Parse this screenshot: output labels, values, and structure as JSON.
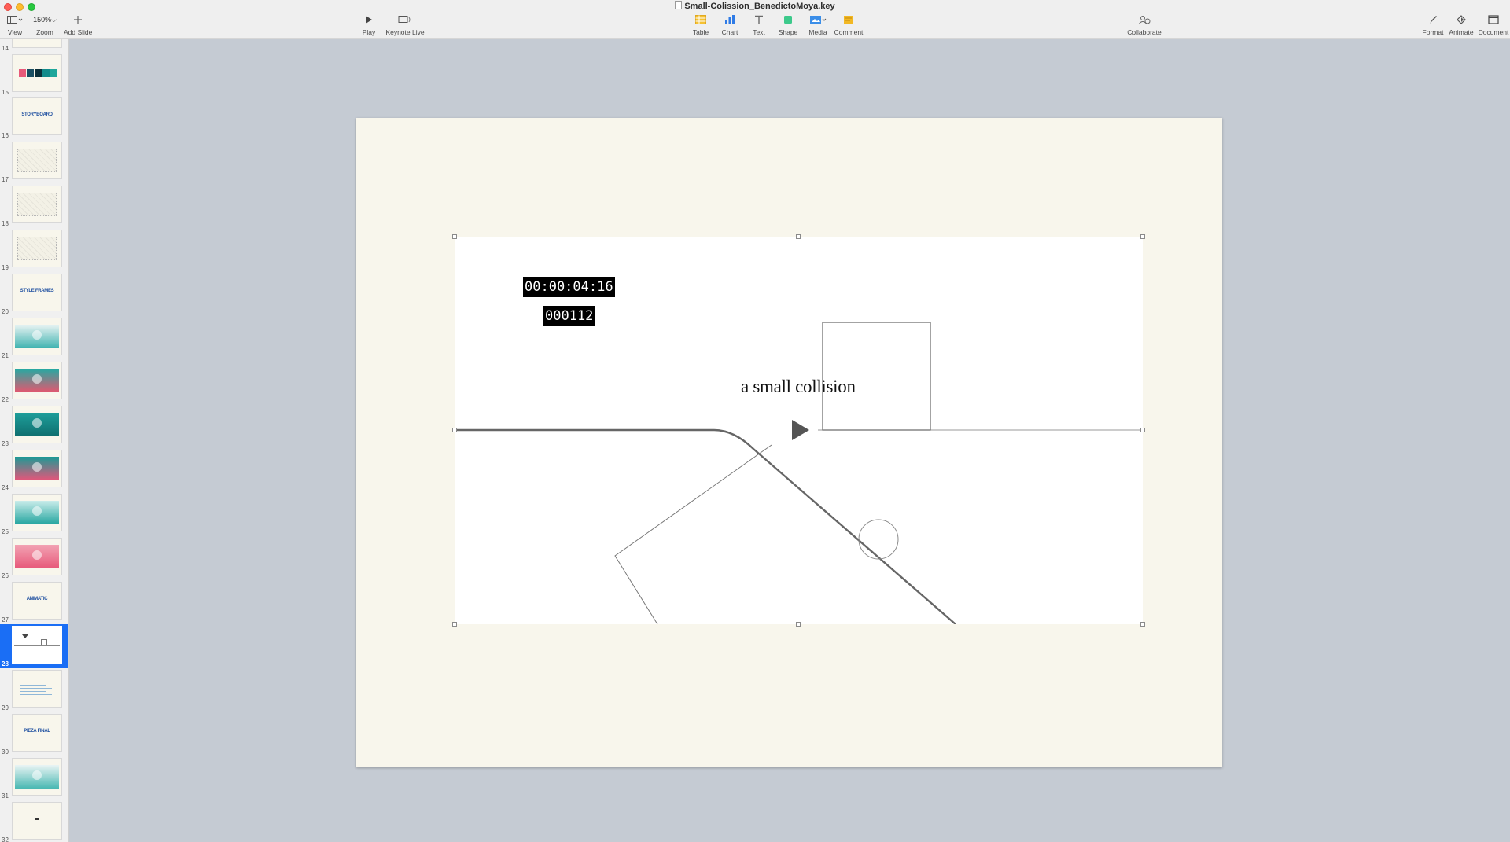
{
  "window": {
    "title": "Small-Colission_BenedictoMoya.key"
  },
  "toolbar": {
    "left": [
      {
        "label": "View",
        "icon": "sidebar-view-icon"
      },
      {
        "label": "Zoom",
        "value": "150%"
      },
      {
        "label": "Add Slide",
        "icon": "plus-icon"
      },
      {
        "label": "Play",
        "icon": "play-icon"
      },
      {
        "label": "Keynote Live",
        "icon": "keynote-live-icon"
      }
    ],
    "center": [
      {
        "label": "Table",
        "icon": "table-icon",
        "color": "#f5c132"
      },
      {
        "label": "Chart",
        "icon": "chart-icon",
        "color": "#2f7be6"
      },
      {
        "label": "Text",
        "icon": "text-icon",
        "color": "#7a7a7a"
      },
      {
        "label": "Shape",
        "icon": "shape-icon",
        "color": "#3cc98b"
      },
      {
        "label": "Media",
        "icon": "media-icon",
        "color": "#3b8ee8"
      },
      {
        "label": "Comment",
        "icon": "comment-icon",
        "color": "#f2b824"
      }
    ],
    "collaborate": {
      "label": "Collaborate",
      "icon": "collaborate-icon"
    },
    "right": [
      {
        "label": "Format",
        "icon": "format-brush-icon"
      },
      {
        "label": "Animate",
        "icon": "animate-icon"
      },
      {
        "label": "Document",
        "icon": "document-icon"
      }
    ]
  },
  "navigator": {
    "selected": 28,
    "slides": [
      {
        "num": "14",
        "type": "blank"
      },
      {
        "num": "15",
        "type": "swatches",
        "colors": [
          "#e85a7a",
          "#1a4f63",
          "#0b2f3a",
          "#138b8b",
          "#1fa79b"
        ]
      },
      {
        "num": "16",
        "type": "title",
        "text": "STORYBOARD"
      },
      {
        "num": "17",
        "type": "sketch"
      },
      {
        "num": "18",
        "type": "sketch"
      },
      {
        "num": "19",
        "type": "sketch"
      },
      {
        "num": "20",
        "type": "title",
        "text": "STYLE FRAMES"
      },
      {
        "num": "21",
        "type": "scene",
        "colors": [
          "#e9f3f3",
          "#3fb3b0"
        ]
      },
      {
        "num": "22",
        "type": "scene",
        "colors": [
          "#26a9a2",
          "#e4566f"
        ]
      },
      {
        "num": "23",
        "type": "scene",
        "colors": [
          "#1e9e9a",
          "#0f6f6f"
        ]
      },
      {
        "num": "24",
        "type": "scene",
        "colors": [
          "#1d9a95",
          "#e6557a"
        ]
      },
      {
        "num": "25",
        "type": "scene",
        "colors": [
          "#c9ecea",
          "#24a59f"
        ]
      },
      {
        "num": "26",
        "type": "scene",
        "colors": [
          "#f2a3b3",
          "#e7587a"
        ]
      },
      {
        "num": "27",
        "type": "title",
        "text": "ANIMATIC"
      },
      {
        "num": "28",
        "type": "current"
      },
      {
        "num": "29",
        "type": "textblock"
      },
      {
        "num": "30",
        "type": "title",
        "text": "PIEZA FINAL"
      },
      {
        "num": "31",
        "type": "scene",
        "colors": [
          "#eaf4f4",
          "#49b8b2"
        ]
      },
      {
        "num": "32",
        "type": "dot"
      }
    ]
  },
  "slide": {
    "timecode": "00:00:04:16",
    "frame": "000112",
    "title": "a small collision"
  }
}
